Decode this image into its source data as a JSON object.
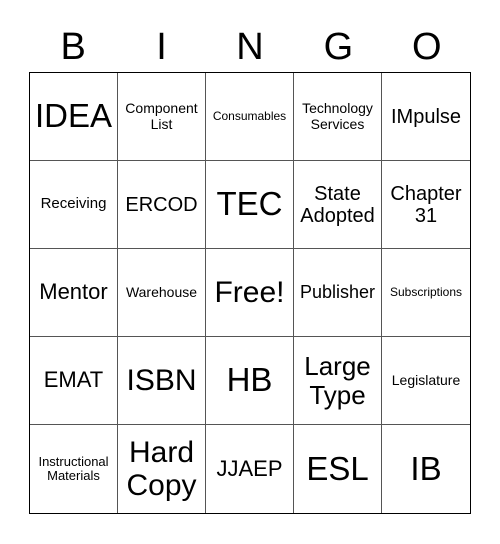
{
  "header": {
    "letters": [
      "B",
      "I",
      "N",
      "G",
      "O"
    ]
  },
  "cells": [
    "IDEA",
    "Component List",
    "Consumables",
    "Technology Services",
    "IMpulse",
    "Receiving",
    "ERCOD",
    "TEC",
    "State Adopted",
    "Chapter 31",
    "Mentor",
    "Warehouse",
    "Free!",
    "Publisher",
    "Subscriptions",
    "EMAT",
    "ISBN",
    "HB",
    "Large Type",
    "Legislature",
    "Instructional Materials",
    "Hard Copy",
    "JJAEP",
    "ESL",
    "IB"
  ]
}
